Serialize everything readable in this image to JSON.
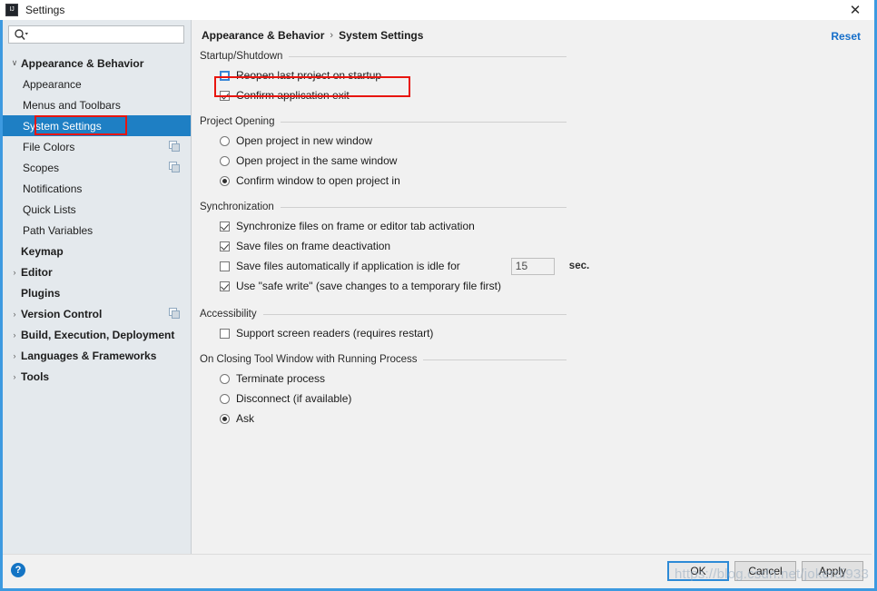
{
  "window": {
    "title": "Settings",
    "app_icon": "intellij-idea-icon",
    "close_label": "✕"
  },
  "search": {
    "value": "",
    "placeholder": "",
    "icon": "search-icon"
  },
  "sidebar": {
    "items": [
      {
        "label": "Appearance & Behavior",
        "level": 0,
        "bold": true,
        "arrow": "∨",
        "selected": false,
        "copy_icon": false
      },
      {
        "label": "Appearance",
        "level": 1,
        "bold": false,
        "arrow": "",
        "selected": false,
        "copy_icon": false
      },
      {
        "label": "Menus and Toolbars",
        "level": 1,
        "bold": false,
        "arrow": "",
        "selected": false,
        "copy_icon": false
      },
      {
        "label": "System Settings",
        "level": 1,
        "bold": false,
        "arrow": "›",
        "selected": true,
        "copy_icon": false
      },
      {
        "label": "File Colors",
        "level": 1,
        "bold": false,
        "arrow": "",
        "selected": false,
        "copy_icon": true
      },
      {
        "label": "Scopes",
        "level": 1,
        "bold": false,
        "arrow": "",
        "selected": false,
        "copy_icon": true
      },
      {
        "label": "Notifications",
        "level": 1,
        "bold": false,
        "arrow": "",
        "selected": false,
        "copy_icon": false
      },
      {
        "label": "Quick Lists",
        "level": 1,
        "bold": false,
        "arrow": "",
        "selected": false,
        "copy_icon": false
      },
      {
        "label": "Path Variables",
        "level": 1,
        "bold": false,
        "arrow": "",
        "selected": false,
        "copy_icon": false
      },
      {
        "label": "Keymap",
        "level": 0,
        "bold": true,
        "arrow": "",
        "selected": false,
        "copy_icon": false
      },
      {
        "label": "Editor",
        "level": 0,
        "bold": true,
        "arrow": "›",
        "selected": false,
        "copy_icon": false
      },
      {
        "label": "Plugins",
        "level": 0,
        "bold": true,
        "arrow": "",
        "selected": false,
        "copy_icon": false
      },
      {
        "label": "Version Control",
        "level": 0,
        "bold": true,
        "arrow": "›",
        "selected": false,
        "copy_icon": true
      },
      {
        "label": "Build, Execution, Deployment",
        "level": 0,
        "bold": true,
        "arrow": "›",
        "selected": false,
        "copy_icon": false
      },
      {
        "label": "Languages & Frameworks",
        "level": 0,
        "bold": true,
        "arrow": "›",
        "selected": false,
        "copy_icon": false
      },
      {
        "label": "Tools",
        "level": 0,
        "bold": true,
        "arrow": "›",
        "selected": false,
        "copy_icon": false
      }
    ]
  },
  "main": {
    "breadcrumb": {
      "root": "Appearance & Behavior",
      "separator": "›",
      "current": "System Settings"
    },
    "reset_label": "Reset",
    "sections": [
      {
        "title": "Startup/Shutdown",
        "options": [
          {
            "type": "checkbox",
            "label": "Reopen last project on startup",
            "checked": false,
            "focused": true
          },
          {
            "type": "checkbox",
            "label": "Confirm application exit",
            "checked": true,
            "focused": false
          }
        ]
      },
      {
        "title": "Project Opening",
        "options": [
          {
            "type": "radio",
            "label": "Open project in new window",
            "checked": false
          },
          {
            "type": "radio",
            "label": "Open project in the same window",
            "checked": false
          },
          {
            "type": "radio",
            "label": "Confirm window to open project in",
            "checked": true
          }
        ]
      },
      {
        "title": "Synchronization",
        "options": [
          {
            "type": "checkbox",
            "label": "Synchronize files on frame or editor tab activation",
            "checked": true,
            "focused": false
          },
          {
            "type": "checkbox",
            "label": "Save files on frame deactivation",
            "checked": true,
            "focused": false
          },
          {
            "type": "checkbox-field",
            "label": "Save files automatically if application is idle for",
            "checked": false,
            "focused": false,
            "field_value": "15",
            "field_suffix": "sec."
          },
          {
            "type": "checkbox",
            "label": "Use \"safe write\" (save changes to a temporary file first)",
            "checked": true,
            "focused": false
          }
        ]
      },
      {
        "title": "Accessibility",
        "options": [
          {
            "type": "checkbox",
            "label": "Support screen readers (requires restart)",
            "checked": false,
            "focused": false
          }
        ]
      },
      {
        "title": "On Closing Tool Window with Running Process",
        "options": [
          {
            "type": "radio",
            "label": "Terminate process",
            "checked": false
          },
          {
            "type": "radio",
            "label": "Disconnect (if available)",
            "checked": false
          },
          {
            "type": "radio",
            "label": "Ask",
            "checked": true
          }
        ]
      }
    ]
  },
  "footer": {
    "help_label": "?",
    "buttons": [
      {
        "label": "OK",
        "default": true
      },
      {
        "label": "Cancel",
        "default": false
      },
      {
        "label": "Apply",
        "default": false
      }
    ]
  },
  "watermark": "https://blog.csdn.net/jokerdi933",
  "colors": {
    "selection_blue": "#1e7fc4",
    "accent_blue": "#3d9ae0",
    "link_blue": "#166fca",
    "annotation_red": "#e8150f",
    "sidebar_bg": "#e4e9ed",
    "panel_bg": "#f1f1f1"
  }
}
